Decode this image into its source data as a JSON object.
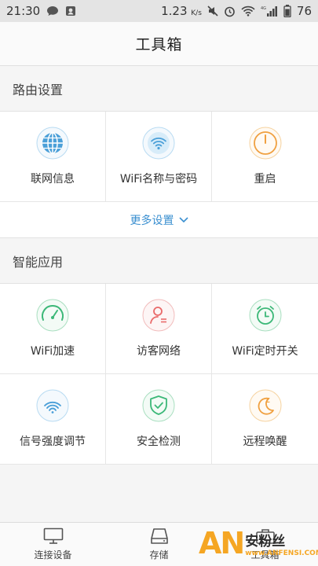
{
  "status_bar": {
    "time": "21:30",
    "speed": "1.23",
    "speed_unit": "K/s",
    "network_tag": "4G",
    "battery": "76",
    "icons": [
      "chat-bubble-icon",
      "app-notification-icon",
      "mute-icon",
      "alarm-icon",
      "wifi-icon",
      "signal-icon",
      "battery-icon"
    ]
  },
  "header": {
    "title": "工具箱"
  },
  "router_settings": {
    "title": "路由设置",
    "items": [
      {
        "label": "联网信息",
        "icon": "globe-icon",
        "color": "#4a9fd8"
      },
      {
        "label": "WiFi名称与密码",
        "icon": "wifi-icon",
        "color": "#4a9fd8"
      },
      {
        "label": "重启",
        "icon": "power-icon",
        "color": "#f0a040"
      }
    ],
    "more_label": "更多设置"
  },
  "smart_apps": {
    "title": "智能应用",
    "items": [
      {
        "label": "WiFi加速",
        "icon": "speedometer-icon",
        "color": "#3cb878"
      },
      {
        "label": "访客网络",
        "icon": "guest-user-icon",
        "color": "#e96a6a"
      },
      {
        "label": "WiFi定时开关",
        "icon": "alarm-clock-icon",
        "color": "#3cb878"
      },
      {
        "label": "信号强度调节",
        "icon": "signal-strength-icon",
        "color": "#4a9fd8"
      },
      {
        "label": "安全检测",
        "icon": "shield-check-icon",
        "color": "#3cb878"
      },
      {
        "label": "远程唤醒",
        "icon": "moon-sleep-icon",
        "color": "#f0a040"
      }
    ]
  },
  "tab_bar": {
    "tabs": [
      {
        "label": "连接设备",
        "icon": "monitor-icon"
      },
      {
        "label": "存储",
        "icon": "storage-icon"
      },
      {
        "label": "工具箱",
        "icon": "toolbox-icon"
      }
    ]
  },
  "watermark": {
    "logo": "AN",
    "text": "安粉丝",
    "url": "www.ANFENSI.COM"
  }
}
